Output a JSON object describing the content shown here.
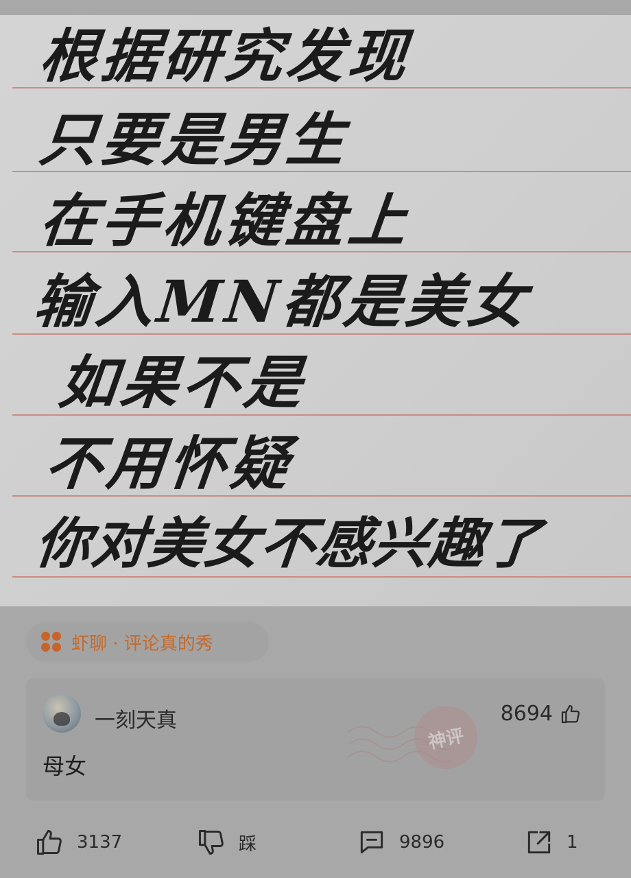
{
  "note": {
    "lines": [
      "根据研究发现",
      "只要是男生",
      "在手机键盘上",
      "输入MN都是美女",
      "如果不是",
      "不用怀疑",
      "你对美女不感兴趣了"
    ]
  },
  "topic": {
    "label": "虾聊 · 评论真的秀"
  },
  "comment": {
    "username": "一刻天真",
    "text": "母女",
    "likes": "8694",
    "badge": "神评"
  },
  "actions": {
    "like_count": "3137",
    "dislike_label": "踩",
    "comment_count": "9896",
    "share_count": "1"
  },
  "colors": {
    "accent": "#c46a2c",
    "rule_line": "#c9847c",
    "text": "#2a2a2a"
  }
}
